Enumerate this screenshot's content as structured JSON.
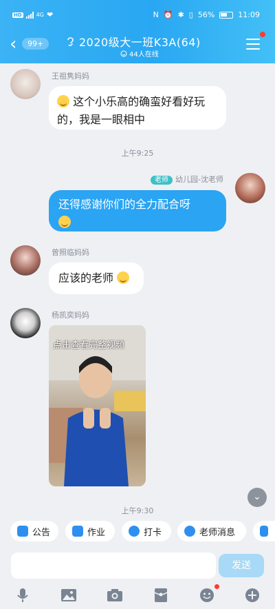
{
  "status_bar": {
    "carrier_badge": "HD",
    "network": "4G",
    "battery": "56%",
    "time": "11:09"
  },
  "header": {
    "unread_count": "99+",
    "title": "2020级大一班K3A(64)",
    "online_count": "44人在线"
  },
  "messages": [
    {
      "sender": "王祖隽妈妈",
      "text": "这个小乐高的确蛮好看好玩的，我是一眼相中"
    },
    {
      "time": "上午9:25"
    },
    {
      "sender_tag": "老师",
      "sender": "幼儿园-沈老师",
      "text": "还得感谢你们的全力配合呀"
    },
    {
      "sender": "曾照临妈妈",
      "text": "应该的老师"
    },
    {
      "sender": "杨凯奕妈妈",
      "video_label": "点击查看完整视频"
    },
    {
      "time": "上午9:30"
    }
  ],
  "quick_actions": [
    "公告",
    "作业",
    "打卡",
    "老师消息"
  ],
  "input": {
    "placeholder": "",
    "send_label": "发送"
  },
  "colors": {
    "header": "#29a7f2",
    "my_bubble": "#2aa4f3",
    "teacher_tag": "#3cc0c7",
    "badge_red": "#ff3b30"
  },
  "toolbar_icons": [
    "mic-icon",
    "image-icon",
    "camera-icon",
    "red-packet-icon",
    "emoji-icon",
    "plus-icon"
  ]
}
